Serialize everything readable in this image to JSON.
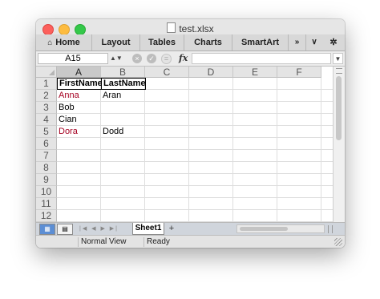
{
  "window": {
    "title": "test.xlsx"
  },
  "ribbon": {
    "tabs": [
      {
        "label": "Home"
      },
      {
        "label": "Layout"
      },
      {
        "label": "Tables"
      },
      {
        "label": "Charts"
      },
      {
        "label": "SmartArt"
      }
    ],
    "more_glyph": "»",
    "collapse_glyph": "∨",
    "options_glyph": "✲"
  },
  "formula_bar": {
    "name_box": "A15",
    "fx_label": "fx",
    "formula": ""
  },
  "sheet": {
    "selected_column": "A",
    "columns": [
      "A",
      "B",
      "C",
      "D",
      "E",
      "F"
    ],
    "rows": [
      "1",
      "2",
      "3",
      "4",
      "5",
      "6",
      "7",
      "8",
      "9",
      "10",
      "11",
      "12"
    ],
    "cells": {
      "A1": "FirstName",
      "B1": "LastName",
      "A2": "Anna",
      "B2": "Aran",
      "A3": "Bob",
      "A4": "Cian",
      "A5": "Dora",
      "B5": "Dodd"
    },
    "highlight_color": "#a50021"
  },
  "tabs_bar": {
    "sheet_tab": "Sheet1",
    "add_sheet": "+"
  },
  "status_bar": {
    "view": "Normal View",
    "state": "Ready"
  }
}
